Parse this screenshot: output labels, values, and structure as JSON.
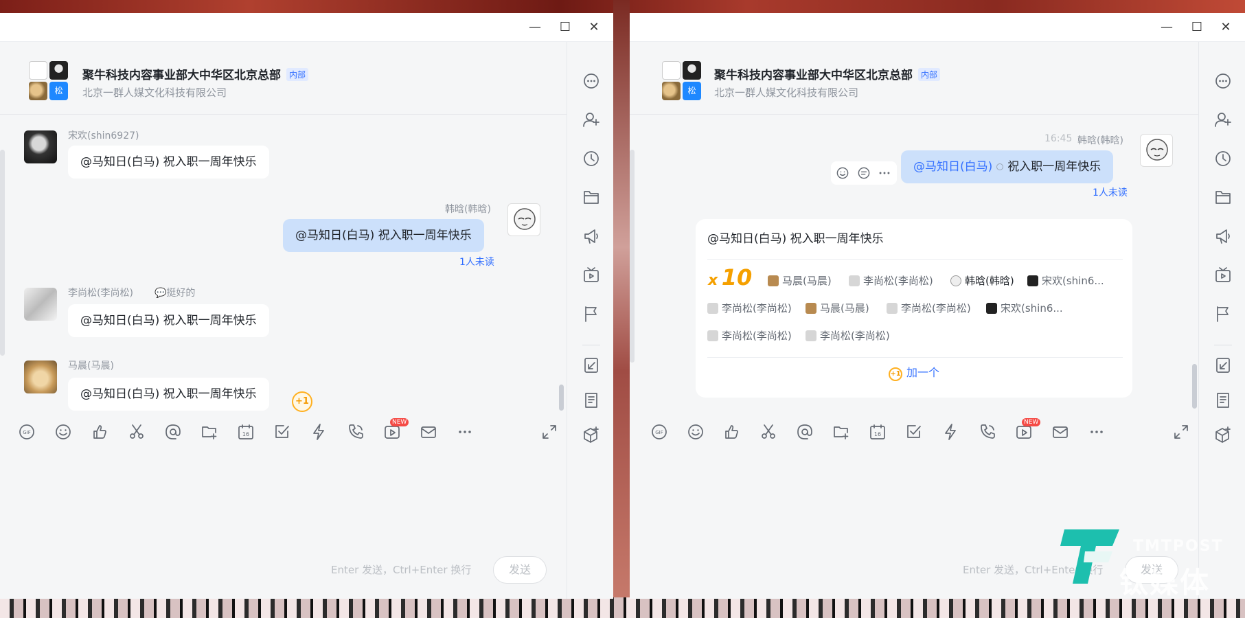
{
  "window_controls": {
    "minimize": "—",
    "maximize": "☐",
    "close": "✕"
  },
  "chat": {
    "group_name": "聚牛科技内容事业部大中华区北京总部",
    "group_tag": "内部",
    "company": "北京一群人媒文化科技有限公司",
    "group_avatar_letter": "松"
  },
  "left": {
    "messages": [
      {
        "sender": "宋欢(shin6927)",
        "text": "@马知日(白马) 祝入职一周年快乐"
      },
      {
        "sender": "韩晗(韩晗)",
        "text": "@马知日(白马) 祝入职一周年快乐",
        "status": "1人未读"
      },
      {
        "sender": "李尚松(李尚松)",
        "reply": "💬挺好的",
        "text": "@马知日(白马) 祝入职一周年快乐"
      },
      {
        "sender": "马晨(马晨)",
        "text": "@马知日(白马) 祝入职一周年快乐",
        "plus": "+1"
      }
    ]
  },
  "right": {
    "time": "16:45",
    "sender": "韩晗(韩晗)",
    "mention": "@马知日(白马)",
    "text": "祝入职一周年快乐",
    "status": "1人未读",
    "card": {
      "text": "@马知日(白马) 祝入职一周年快乐",
      "count_x": "x",
      "count_num": "10",
      "chips": [
        "马晨(马晨)",
        "李尚松(李尚松)",
        "韩晗(韩晗)",
        "宋欢(shin6...",
        "李尚松(李尚松)",
        "马晨(马晨)",
        "李尚松(李尚松)",
        "宋欢(shin6...",
        "李尚松(李尚松)",
        "李尚松(李尚松)"
      ],
      "add_label": "加一个",
      "add_icon": "+1"
    }
  },
  "toolbar": {
    "new_badge": "NEW"
  },
  "input": {
    "hint": "Enter 发送，Ctrl+Enter 换行",
    "send": "发送"
  },
  "watermark": {
    "en": "TMTPOST",
    "cn": "钛媒体"
  },
  "colors": {
    "accent": "#3370ff",
    "bubble_self": "#cce0fb",
    "plus_one": "#f59a00"
  },
  "icons": {
    "sidebar": [
      "more-icon",
      "add-member-icon",
      "history-icon",
      "folder-icon",
      "announcement-icon",
      "live-icon",
      "flag-icon",
      "docs-icon",
      "notes-icon",
      "apps-icon"
    ],
    "toolbar": [
      "gif-icon",
      "emoji-icon",
      "thumbs-up-icon",
      "scissors-icon",
      "mention-icon",
      "add-folder-icon",
      "calendar-icon",
      "task-icon",
      "lightning-icon",
      "call-icon",
      "video-icon",
      "mail-icon",
      "more-icon",
      "expand-icon"
    ]
  }
}
